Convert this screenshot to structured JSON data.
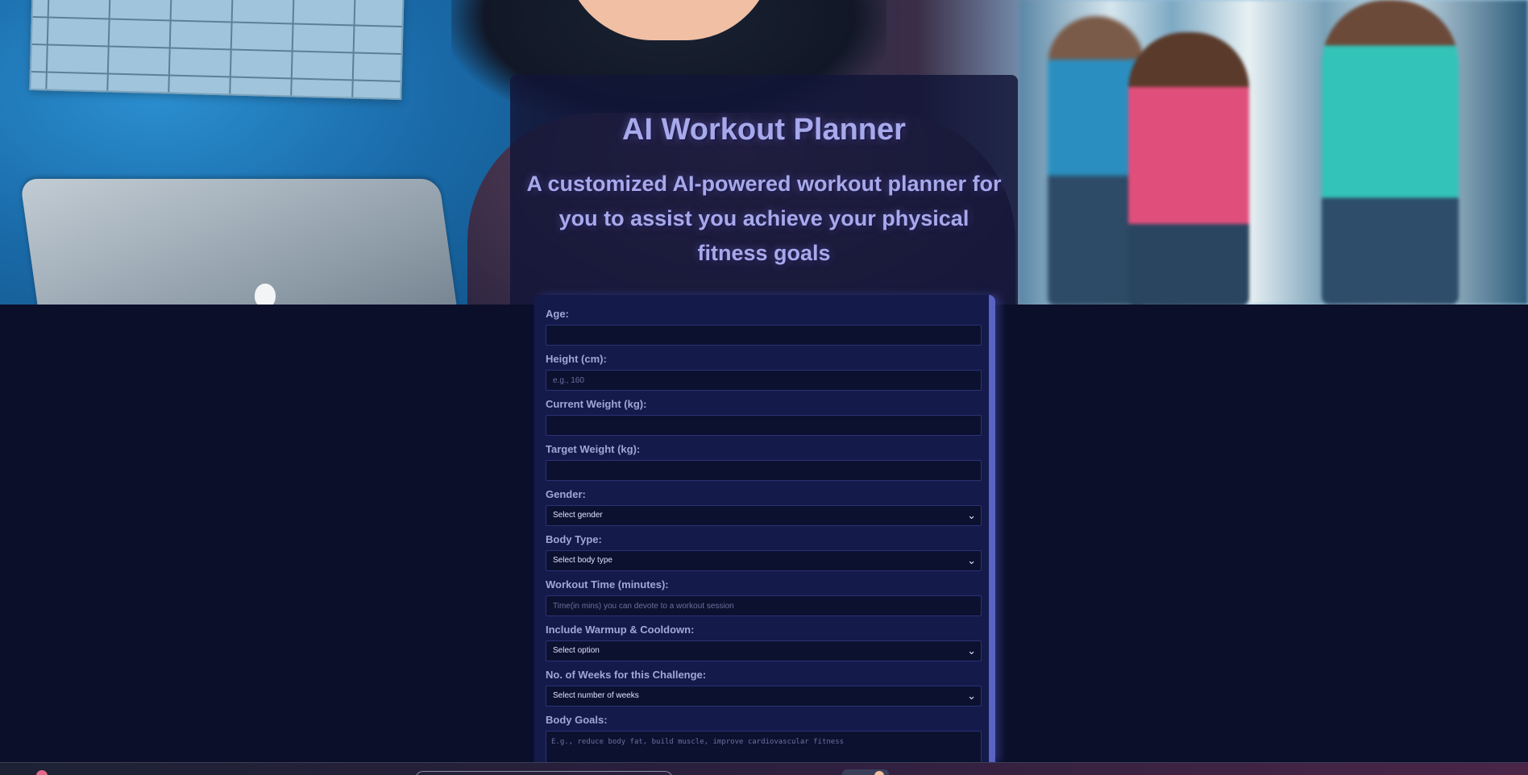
{
  "header": {
    "title": "AI Workout Planner",
    "subtitle": "A customized AI-powered workout planner for you to assist you achieve your physical fitness goals"
  },
  "form": {
    "age": {
      "label": "Age:",
      "value": "",
      "placeholder": ""
    },
    "height": {
      "label": "Height (cm):",
      "value": "",
      "placeholder": "e.g., 160"
    },
    "current_weight": {
      "label": "Current Weight (kg):",
      "value": "",
      "placeholder": ""
    },
    "target_weight": {
      "label": "Target Weight (kg):",
      "value": "",
      "placeholder": ""
    },
    "gender": {
      "label": "Gender:",
      "selected": "Select gender"
    },
    "body_type": {
      "label": "Body Type:",
      "selected": "Select body type"
    },
    "workout_time": {
      "label": "Workout Time (minutes):",
      "value": "",
      "placeholder": "Time(in mins) you can devote to a workout session"
    },
    "warmup": {
      "label": "Include Warmup & Cooldown:",
      "selected": "Select option"
    },
    "weeks": {
      "label": "No. of Weeks for this Challenge:",
      "selected": "Select number of weeks"
    },
    "body_goals": {
      "label": "Body Goals:",
      "value": "",
      "placeholder": "E.g., reduce body fat, build muscle, improve cardiovascular fitness"
    }
  },
  "icons": {
    "select_chevron": "chevron-down-icon"
  },
  "colors": {
    "page_background": "#0b0f2a",
    "form_background": "#141a4a",
    "input_background": "#0c1130",
    "accent_border": "#5963c4",
    "heading_text": "#a7a9ec",
    "label_text": "#a0a8d6"
  }
}
